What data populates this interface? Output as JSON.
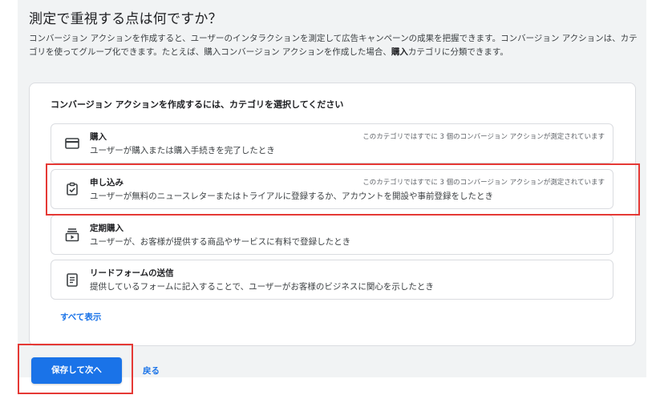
{
  "header": {
    "title": "測定で重視する点は何ですか？",
    "description_part1": "コンバージョン アクションを作成すると、ユーザーのインタラクションを測定して広告キャンペーンの成果を把握できます。コンバージョン アクションは、カテゴリを使ってグループ化できます。たとえば、購入コンバージョン アクションを作成した場合、",
    "description_bold": "購入",
    "description_part2": "カテゴリに分類できます。"
  },
  "card": {
    "heading": "コンバージョン アクションを作成するには、カテゴリを選択してください",
    "options": [
      {
        "icon": "credit-card-icon",
        "title": "購入",
        "description": "ユーザーが購入または購入手続きを完了したとき",
        "note": "このカテゴリではすでに 3 個のコンバージョン アクションが測定されています"
      },
      {
        "icon": "clipboard-check-icon",
        "title": "申し込み",
        "description": "ユーザーが無料のニュースレターまたはトライアルに登録するか、アカウントを開設や事前登録をしたとき",
        "note": "このカテゴリではすでに 3 個のコンバージョン アクションが測定されています"
      },
      {
        "icon": "subscriptions-icon",
        "title": "定期購入",
        "description": "ユーザーが、お客様が提供する商品やサービスに有料で登録したとき",
        "note": ""
      },
      {
        "icon": "form-icon",
        "title": "リードフォームの送信",
        "description": "提供しているフォームに記入することで、ユーザーがお客様のビジネスに関心を示したとき",
        "note": ""
      }
    ],
    "view_all": "すべて表示"
  },
  "footer": {
    "save_next": "保存して次へ",
    "back": "戻る"
  },
  "colors": {
    "accent": "#1a73e8",
    "highlight": "#e53935"
  }
}
